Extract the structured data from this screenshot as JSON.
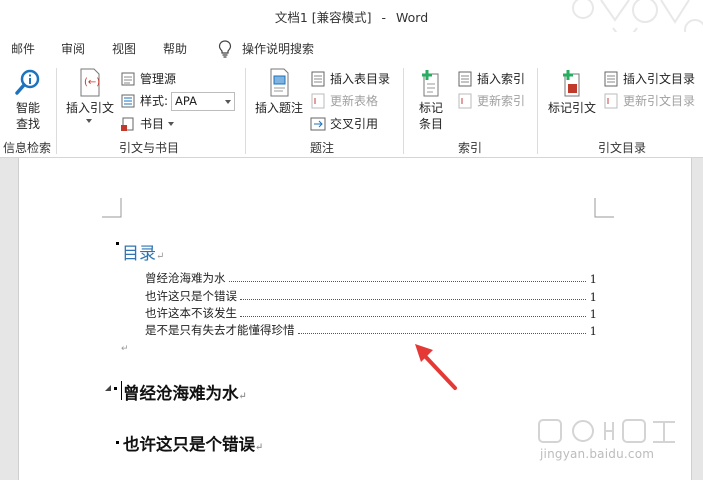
{
  "window": {
    "doc_name": "文档1",
    "mode": "[兼容模式]",
    "separator": "-",
    "app": "Word"
  },
  "menu": {
    "tabs": [
      "邮件",
      "审阅",
      "视图",
      "帮助"
    ],
    "search": "操作说明搜索"
  },
  "ribbon": {
    "search_group": {
      "button_line1": "智能",
      "button_line2": "查找",
      "label": "信息检索"
    },
    "citations": {
      "insert_citation": "插入引文",
      "manage_sources": "管理源",
      "style_label": "样式:",
      "style_value": "APA",
      "bibliography": "书目",
      "label": "引文与书目"
    },
    "captions": {
      "insert_caption": "插入题注",
      "insert_table_of_figures": "插入表目录",
      "update_table": "更新表格",
      "cross_reference": "交叉引用",
      "label": "题注"
    },
    "index": {
      "mark_entry_line1": "标记",
      "mark_entry_line2": "条目",
      "insert_index": "插入索引",
      "update_index": "更新索引",
      "label": "索引"
    },
    "toa": {
      "mark_citation": "标记引文",
      "insert_toa": "插入引文目录",
      "update_toa": "更新引文目录",
      "label": "引文目录"
    }
  },
  "document": {
    "toc_heading": "目录",
    "toc_entries": [
      {
        "text": "曾经沧海难为水",
        "page": "1"
      },
      {
        "text": "也许这只是个错误",
        "page": "1"
      },
      {
        "text": "也许这本不该发生",
        "page": "1"
      },
      {
        "text": "是不是只有失去才能懂得珍惜",
        "page": "1"
      }
    ],
    "para_mark": "↵",
    "headings": [
      "曾经沧海难为水",
      "也许这只是个错误"
    ]
  },
  "watermark": {
    "text": "jingyan.baidu.com"
  },
  "colors": {
    "accent": "#2e74b5",
    "arrow": "#e53935",
    "icon_red": "#c0392b",
    "icon_blue": "#1e73be"
  }
}
